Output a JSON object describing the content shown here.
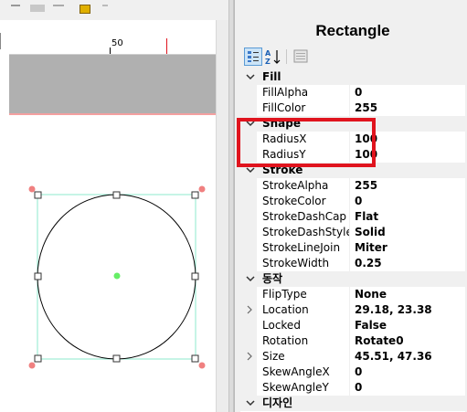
{
  "ruler": {
    "label": "50"
  },
  "panel": {
    "title": "Rectangle",
    "toolbar": [
      {
        "icon": "categorized-icon"
      },
      {
        "icon": "alphabetical-sort-icon"
      },
      {
        "icon": "property-pages-icon"
      }
    ]
  },
  "categories": [
    {
      "name": "Fill",
      "props": [
        {
          "name": "FillAlpha",
          "value": "0"
        },
        {
          "name": "FillColor",
          "value": "255"
        }
      ]
    },
    {
      "name": "Shape",
      "props": [
        {
          "name": "RadiusX",
          "value": "100"
        },
        {
          "name": "RadiusY",
          "value": "100"
        }
      ]
    },
    {
      "name": "Stroke",
      "props": [
        {
          "name": "StrokeAlpha",
          "value": "255"
        },
        {
          "name": "StrokeColor",
          "value": "0"
        },
        {
          "name": "StrokeDashCap",
          "value": "Flat"
        },
        {
          "name": "StrokeDashStyle",
          "value": "Solid"
        },
        {
          "name": "StrokeLineJoin",
          "value": "Miter"
        },
        {
          "name": "StrokeWidth",
          "value": "0.25"
        }
      ]
    },
    {
      "name": "동작",
      "props": [
        {
          "name": "FlipType",
          "value": "None"
        },
        {
          "name": "Location",
          "value": "29.18, 23.38",
          "expandable": true
        },
        {
          "name": "Locked",
          "value": "False"
        },
        {
          "name": "Rotation",
          "value": "Rotate0"
        },
        {
          "name": "Size",
          "value": "45.51, 47.36",
          "expandable": true
        },
        {
          "name": "SkewAngleX",
          "value": "0"
        },
        {
          "name": "SkewAngleY",
          "value": "0"
        }
      ]
    },
    {
      "name": "디자인",
      "props": []
    }
  ],
  "colors": {
    "highlight": "#e0141e",
    "selection": "#8ee8cc",
    "handle_rotate": "#f08080",
    "center": "#66ee66"
  }
}
